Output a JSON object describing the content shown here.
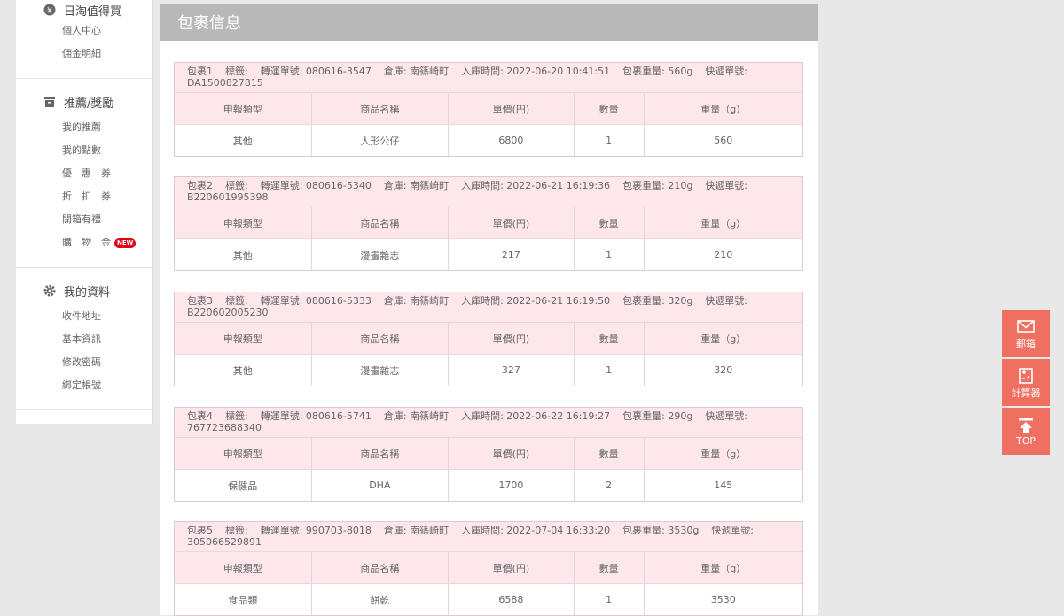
{
  "sidebar": {
    "sections": [
      {
        "title": "日淘值得買",
        "icon": "coin-icon",
        "items": [
          "個人中心",
          "佣金明細"
        ]
      },
      {
        "title": "推薦/獎勵",
        "icon": "gift-box-icon",
        "items": [
          "我的推薦",
          "我的點數",
          "優　惠　券",
          "折　扣　券",
          "開箱有禮",
          "購　物　金"
        ]
      },
      {
        "title": "我的資料",
        "icon": "gear-icon",
        "items": [
          "收件地址",
          "基本資訊",
          "修改密碼",
          "綁定帳號"
        ]
      }
    ],
    "new_badge": "NEW"
  },
  "main": {
    "title": "包裹信息",
    "columns": [
      "申報類型",
      "商品名稱",
      "單價(円)",
      "數量",
      "重量（g）"
    ],
    "packages": [
      {
        "name": "包裹1",
        "tag": "標籤:",
        "transfer": "轉運單號: 080616-3547",
        "warehouse": "倉庫: 南篠崎町",
        "time": "入庫時間: 2022-06-20 10:41:51",
        "weight": "包裹重量: 560g",
        "express_label": "快遞單號:",
        "express_no": "DA1500827815",
        "row": [
          "其他",
          "人形公仔",
          "6800",
          "1",
          "560"
        ]
      },
      {
        "name": "包裹2",
        "tag": "標籤:",
        "transfer": "轉運單號: 080616-5340",
        "warehouse": "倉庫: 南篠崎町",
        "time": "入庫時間: 2022-06-21 16:19:36",
        "weight": "包裹重量: 210g",
        "express_label": "快遞單號:",
        "express_no": "B220601995398",
        "row": [
          "其他",
          "漫畫雜志",
          "217",
          "1",
          "210"
        ]
      },
      {
        "name": "包裹3",
        "tag": "標籤:",
        "transfer": "轉運單號: 080616-5333",
        "warehouse": "倉庫: 南篠崎町",
        "time": "入庫時間: 2022-06-21 16:19:50",
        "weight": "包裹重量: 320g",
        "express_label": "快遞單號:",
        "express_no": "B220602005230",
        "row": [
          "其他",
          "漫畫雜志",
          "327",
          "1",
          "320"
        ]
      },
      {
        "name": "包裹4",
        "tag": "標籤:",
        "transfer": "轉運單號: 080616-5741",
        "warehouse": "倉庫: 南篠崎町",
        "time": "入庫時間: 2022-06-22 16:19:27",
        "weight": "包裹重量: 290g",
        "express_label": "快遞單號:",
        "express_no": "767723688340",
        "row": [
          "保健品",
          "DHA",
          "1700",
          "2",
          "145"
        ]
      },
      {
        "name": "包裹5",
        "tag": "標籤:",
        "transfer": "轉運單號: 990703-8018",
        "warehouse": "倉庫: 南篠崎町",
        "time": "入庫時間: 2022-07-04 16:33:20",
        "weight": "包裹重量: 3530g",
        "express_label": "快遞單號:",
        "express_no": "305066529891",
        "row": [
          "食品類",
          "餅乾",
          "6588",
          "1",
          "3530"
        ]
      }
    ]
  },
  "float": {
    "mail": "郵箱",
    "calc": "計算器",
    "top": "TOP"
  },
  "colors": {
    "accent": "#ef6f60",
    "header_bg": "#b8b8b8",
    "row_pink": "#fde7ea",
    "badge": "#e60012"
  }
}
